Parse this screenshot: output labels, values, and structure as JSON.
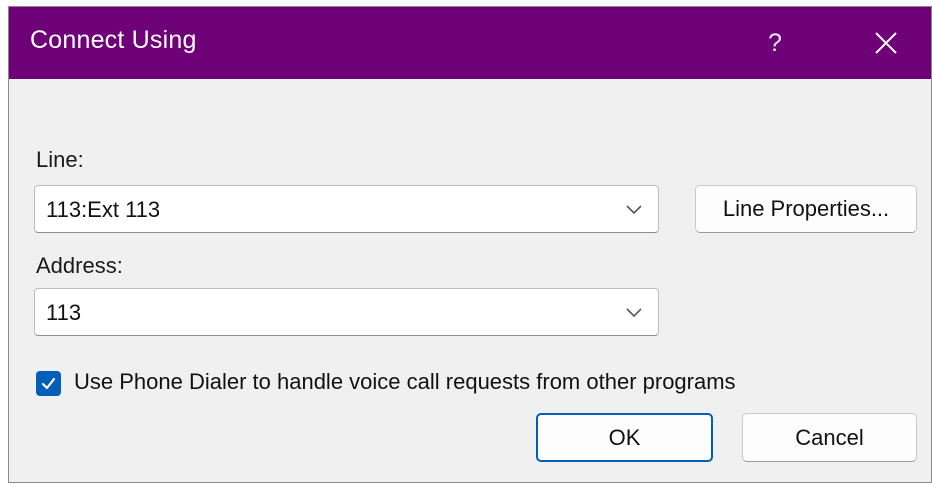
{
  "window": {
    "title": "Connect Using",
    "help_label": "?",
    "close_icon": "close-icon"
  },
  "line": {
    "label": "Line:",
    "value": "113:Ext 113",
    "properties_button": "Line Properties..."
  },
  "address": {
    "label": "Address:",
    "value": "113"
  },
  "option": {
    "label": "Use Phone Dialer to handle voice call requests from other programs",
    "checked": true
  },
  "buttons": {
    "ok": "OK",
    "cancel": "Cancel"
  },
  "colors": {
    "titlebar": "#6e0078",
    "accent": "#005fb8",
    "dialog_bg": "#f0f0f0"
  }
}
